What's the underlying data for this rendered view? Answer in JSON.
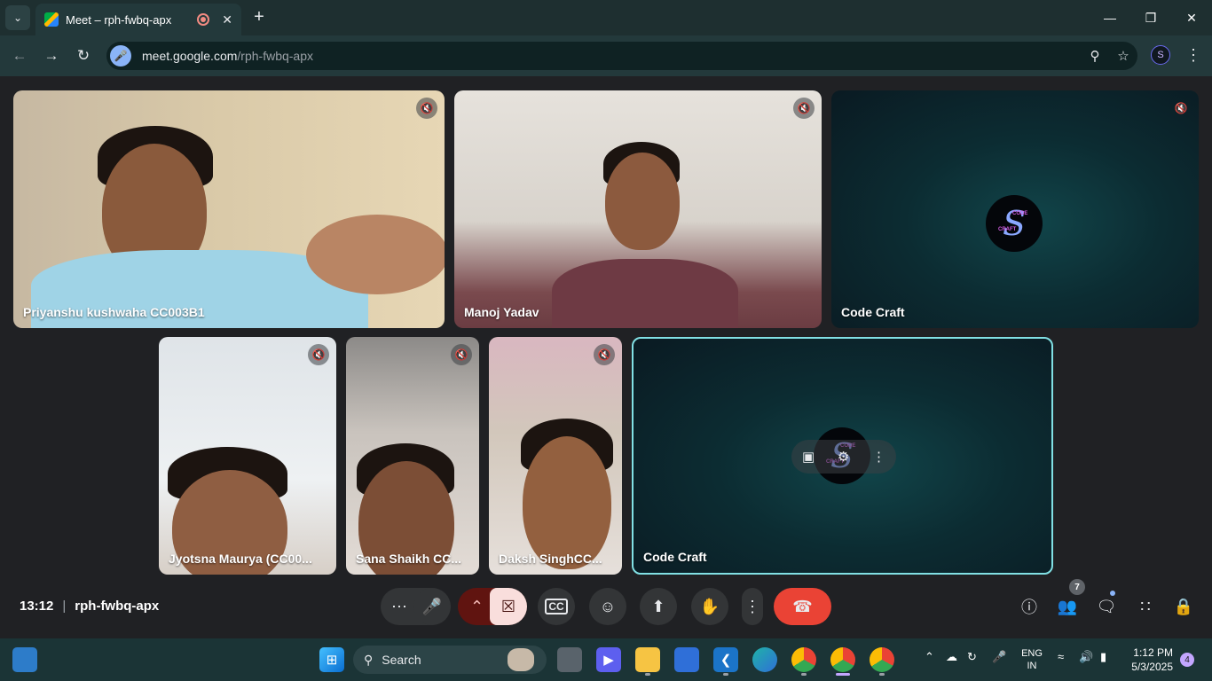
{
  "browser": {
    "tab_title": "Meet – rph-fwbq-apx",
    "url_domain": "meet.google.com",
    "url_path": "/rph-fwbq-apx",
    "new_tab_label": "+",
    "tab_close": "✕",
    "tab_search": "⌄"
  },
  "participants": [
    {
      "name": "Priyanshu kushwaha CC003B1",
      "muted": true
    },
    {
      "name": "Manoj Yadav",
      "muted": true
    },
    {
      "name": "Code Craft",
      "muted": true
    },
    {
      "name": "Jyotsna Maurya (CC00...",
      "muted": true
    },
    {
      "name": "Sana Shaikh CC...",
      "muted": true
    },
    {
      "name": "Daksh SinghCC...",
      "muted": true
    },
    {
      "name": "Code Craft",
      "muted": false,
      "self": true
    }
  ],
  "logo": {
    "s": "S",
    "line1": "CODE",
    "line2": "CRAFT"
  },
  "meeting": {
    "time": "13:12",
    "separator": "|",
    "code": "rph-fwbq-apx"
  },
  "controls": {
    "more": "⋯",
    "participants_count": "7"
  },
  "taskbar": {
    "search_label": "Search",
    "lang_line1": "ENG",
    "lang_line2": "IN",
    "time": "1:12 PM",
    "date": "5/3/2025",
    "notification_count": "4"
  },
  "colors": {
    "accent_border": "#81e0e4",
    "end_call": "#ea4335",
    "cam_off": "#f9dedc"
  }
}
